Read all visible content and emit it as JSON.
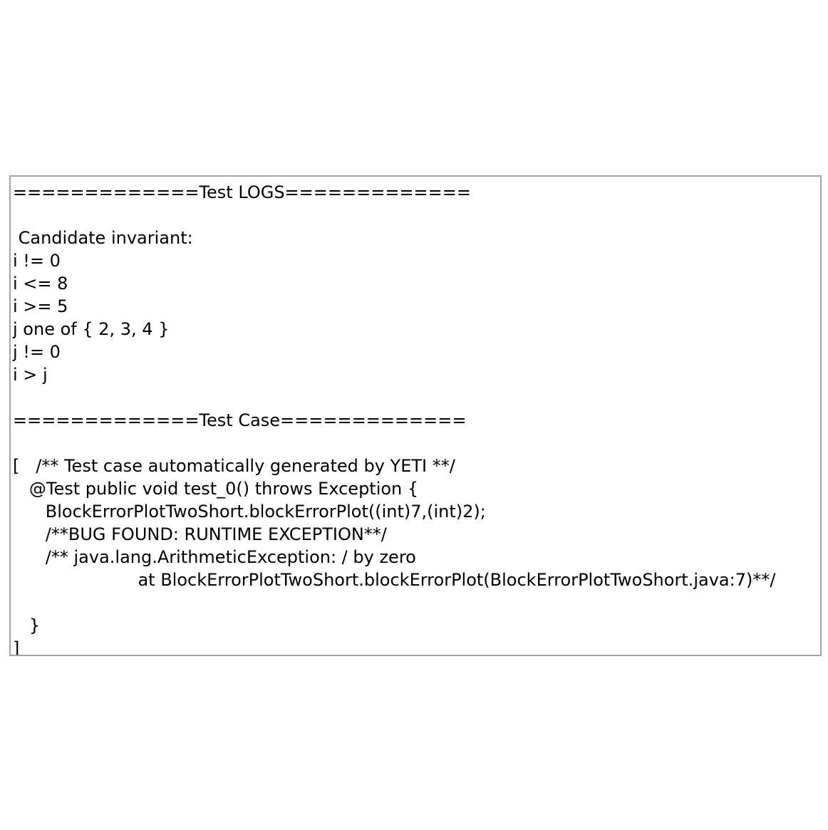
{
  "log": {
    "lines": [
      "=============Test LOGS=============",
      "",
      " Candidate invariant:",
      "i != 0",
      "i <= 8",
      "i >= 5",
      "j one of { 2, 3, 4 }",
      "j != 0",
      "i > j",
      "",
      "=============Test Case=============",
      "",
      "[   /** Test case automatically generated by YETI **/",
      "   @Test public void test_0() throws Exception {",
      "      BlockErrorPlotTwoShort.blockErrorPlot((int)7,(int)2);",
      "      /**BUG FOUND: RUNTIME EXCEPTION**/",
      "      /** java.lang.ArithmeticException: / by zero",
      "                       at BlockErrorPlotTwoShort.blockErrorPlot(BlockErrorPlotTwoShort.java:7)**/",
      "",
      "   }",
      "]"
    ]
  }
}
